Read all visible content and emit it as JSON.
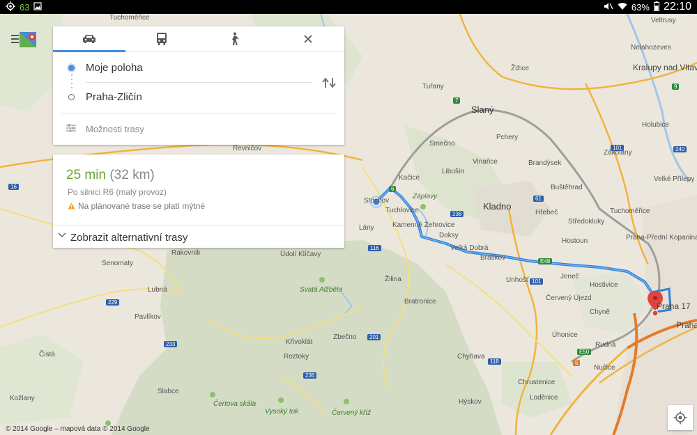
{
  "status_bar": {
    "left_number": "63",
    "battery": "63%",
    "time": "22:10"
  },
  "directions": {
    "modes": [
      {
        "name": "car",
        "icon": "car-icon"
      },
      {
        "name": "transit",
        "icon": "bus-icon"
      },
      {
        "name": "walk",
        "icon": "walk-icon"
      }
    ],
    "origin": "Moje poloha",
    "destination": "Praha-Zličín",
    "options_label": "Možnosti trasy"
  },
  "route": {
    "duration_minutes": "25",
    "duration_unit": "min",
    "distance": "(32 km)",
    "via": "Po silnici R6 (malý provoz)",
    "warning": "Na plánované trase se platí mýtné",
    "alternatives_label": "Zobrazit alternativní trasy"
  },
  "map": {
    "attribution": "© 2014 Google – mapová data © 2014 Google",
    "places": [
      "Tuchoměřice",
      "Kačice",
      "Záplavy",
      "Libušín",
      "Vinařice",
      "Kladno",
      "Stochov",
      "Tuchlovice",
      "Kamenné Žehrovice",
      "Doksy",
      "Lány",
      "Velká Dobrá",
      "Braškov",
      "Unhošť",
      "Hostivice",
      "Jeneč",
      "Červený Újezd",
      "Chyně",
      "Praha 17",
      "Praha",
      "Rudná",
      "Nučice",
      "Úhonice",
      "Bratronice",
      "Žilina",
      "Údolí Klíčavy",
      "Svatá Alžběta",
      "Rakovník",
      "Senomaty",
      "Lubná",
      "Pavlíkov",
      "Čistá",
      "Kožlany",
      "Slabce",
      "Křivoklát",
      "Roztoky",
      "Zbečno",
      "Chyňava",
      "Hýskov",
      "Čertova skála",
      "Vysoký tok",
      "Červený kříž",
      "Chrustenice",
      "Loděnice",
      "Slaný",
      "Tuřany",
      "Smečno",
      "Pchery",
      "Brandýsek",
      "Zákolany",
      "Buštěhrad",
      "Hřebeč",
      "Středokluky",
      "Tuchoměřice",
      "Hostoun",
      "Praha-Přední Kopanina",
      "Holubice",
      "Kralupy nad Vltavou",
      "Velké Přílepy",
      "Nelahozeves",
      "Veltrusy",
      "Žižice",
      "Řevničov",
      "Bratronice"
    ],
    "road_shields": [
      "6",
      "7",
      "101",
      "118",
      "229",
      "233",
      "236",
      "201",
      "116",
      "238",
      "61",
      "E48",
      "E50",
      "5",
      "240",
      "9",
      "16",
      "101"
    ]
  }
}
